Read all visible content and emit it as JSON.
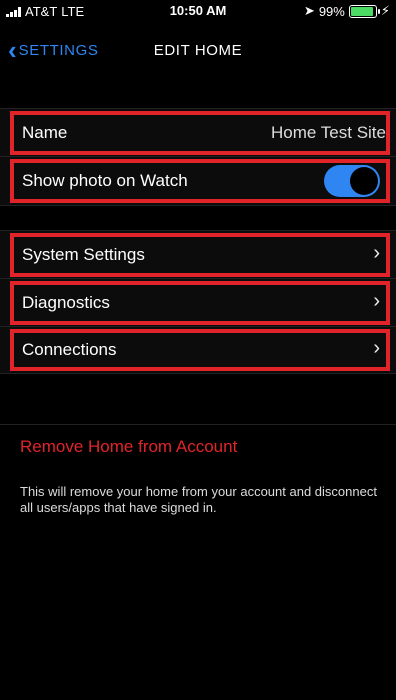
{
  "status_bar": {
    "carrier": "AT&T",
    "network": "LTE",
    "time": "10:50 AM",
    "battery_percent": "99%",
    "battery_level": 0.99,
    "icons": [
      "signal-icon",
      "location-icon",
      "battery-icon",
      "charging-icon"
    ]
  },
  "nav": {
    "back_label": "Settings",
    "title": "Edit Home"
  },
  "rows": {
    "name_label": "Name",
    "name_value": "Home Test Site",
    "photo_label": "Show photo on Watch",
    "photo_toggle_on": true,
    "system_settings_label": "System Settings",
    "diagnostics_label": "Diagnostics",
    "connections_label": "Connections"
  },
  "remove": {
    "label": "Remove Home from Account",
    "description": "This will remove your home from your account and disconnect all users/apps that have signed in."
  },
  "colors": {
    "accent_blue": "#2f86f3",
    "highlight_red": "#e1242a",
    "remove_red": "#e1242a",
    "background": "#000000"
  }
}
